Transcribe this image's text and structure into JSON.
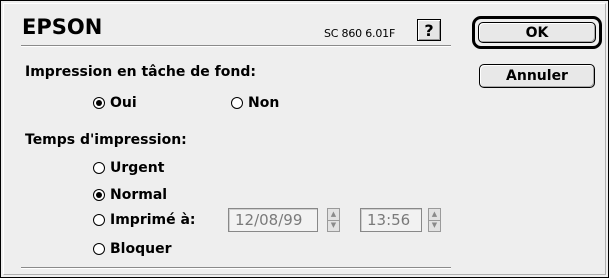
{
  "header": {
    "brand": "EPSON",
    "version": "SC 860 6.01F",
    "help_label": "?"
  },
  "buttons": {
    "ok_label": "OK",
    "cancel_label": "Annuler"
  },
  "background": {
    "label": "Impression en tâche de fond:",
    "options": [
      {
        "label": "Oui",
        "checked": true
      },
      {
        "label": "Non",
        "checked": false
      }
    ]
  },
  "print_time": {
    "label": "Temps d'impression:",
    "options": [
      {
        "label": "Urgent",
        "checked": false
      },
      {
        "label": "Normal",
        "checked": true
      },
      {
        "label": "Imprimé à:",
        "checked": false
      },
      {
        "label": "Bloquer",
        "checked": false
      }
    ],
    "date_value": "12/08/99",
    "time_value": "13:56"
  },
  "colors": {
    "dialog_bg": "#eeeeee",
    "disabled_text": "#7a7a7a"
  }
}
